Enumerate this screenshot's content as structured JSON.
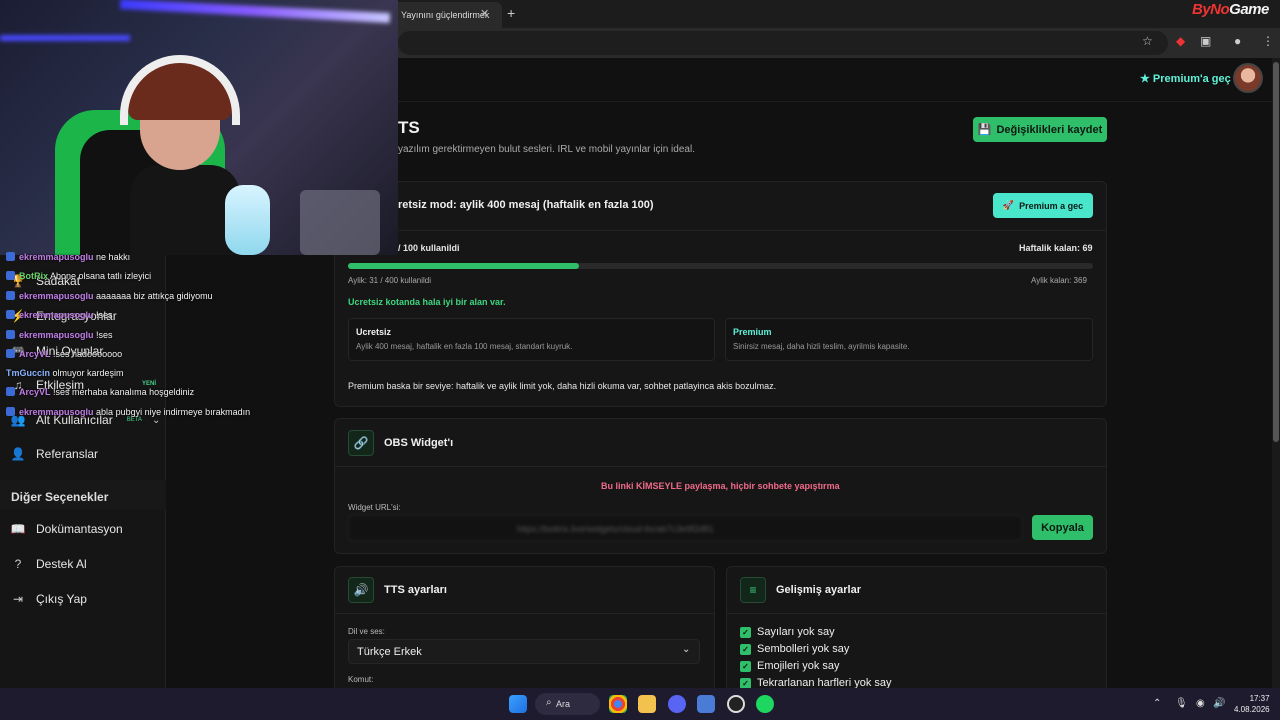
{
  "browser": {
    "tab_title": "Yayınını güçlendirmek",
    "tab_close": "✕",
    "new_tab": "+",
    "brand_left": "ByNo",
    "brand_right": "Game"
  },
  "topbar": {
    "premium_link": "Premium'a geç"
  },
  "header": {
    "title": "TS",
    "subtitle": "yazılım gerektirmeyen bulut sesleri. IRL ve mobil yayınlar için ideal.",
    "save_button": "Değişiklikleri kaydet"
  },
  "quota_card": {
    "mode_title": "retsiz mod: aylik 400 mesaj (haftalik en fazla 100)",
    "premium_button": "Premium a gec",
    "weekly_used": "/ 100 kullanildi",
    "weekly_left": "Haftalik kalan: 69",
    "weekly_progress": 0.31,
    "monthly_used": "Aylik: 31 / 400 kullanildi",
    "monthly_left": "Aylik kalan: 369",
    "status_message": "Ucretsiz kotanda hala iyi bir alan var.",
    "plans": [
      {
        "name": "Ucretsiz",
        "desc": "Aylik 400 mesaj, haftalik en fazla 100 mesaj, standart kuyruk."
      },
      {
        "name": "Premium",
        "desc": "Sinirsiz mesaj, daha hizli teslim, ayrilmis kapasite."
      }
    ],
    "premium_note": "Premium baska bir seviye: haftalik ve aylik limit yok, daha hizli okuma var, sohbet patlayinca akis bozulmaz."
  },
  "obs_card": {
    "title": "OBS Widget'ı",
    "warning": "Bu linki KİMSEYLE paylaşma, hiçbir sohbete yapıştırma",
    "url_label": "Widget URL'si:",
    "url_value": "https://bottrix.live/widgets/cloud-tts/ab7c3e9f2d81",
    "copy_button": "Kopyala"
  },
  "tts_card": {
    "title": "TTS ayarları",
    "voice_label": "Dil ve ses:",
    "voice_value": "Türkçe Erkek",
    "command_label": "Komut:"
  },
  "advanced_card": {
    "title": "Gelişmiş ayarlar",
    "options": [
      {
        "label": "Sayıları yok say",
        "checked": true
      },
      {
        "label": "Sembolleri yok say",
        "checked": true
      },
      {
        "label": "Emojileri yok say",
        "checked": true
      },
      {
        "label": "Tekrarlanan harfleri yok say",
        "checked": true
      }
    ]
  },
  "sidebar": {
    "items": [
      {
        "label": "Sadakat",
        "icon": "trophy-icon"
      },
      {
        "label": "Entegrasyonlar",
        "icon": "plug-icon"
      },
      {
        "label": "Mini Oyunlar",
        "icon": "gamepad-icon"
      },
      {
        "label": "Etkileşim",
        "icon": "music-icon"
      },
      {
        "label": "Alt Kullanıcılar",
        "icon": "users-icon",
        "badge": "BETA"
      },
      {
        "label": "Referanslar",
        "icon": "user-plus-icon"
      }
    ],
    "new_badge": "YENİ",
    "section_title": "Diğer Seçenekler",
    "other": [
      {
        "label": "Dokümantasyon",
        "icon": "book-icon"
      },
      {
        "label": "Destek Al",
        "icon": "help-icon"
      },
      {
        "label": "Çıkış Yap",
        "icon": "logout-icon"
      }
    ]
  },
  "chat": [
    {
      "user": "ekremmapusoglu",
      "text": "ne hakkı",
      "color": "#c07de8"
    },
    {
      "user": "BotRix",
      "text": "Abone olsana tatlı izleyici",
      "color": "#6bd36b"
    },
    {
      "user": "ekremmapusoglu",
      "text": "aaaaaaa biz attıkça gidiyomu",
      "color": "#c07de8"
    },
    {
      "user": "ekremmapusoglu",
      "text": "!ses",
      "color": "#c07de8"
    },
    {
      "user": "ekremmapusoglu",
      "text": "!ses",
      "color": "#c07de8"
    },
    {
      "user": "ArcyVL",
      "text": "!ses hadooooooo",
      "color": "#c07de8"
    },
    {
      "user": "TmGuccin",
      "text": "olmuyor kardeşim",
      "color": "#8ab4ff"
    },
    {
      "user": "ArcyVL",
      "text": "!ses merhaba kanalıma hoşgeldiniz",
      "color": "#c07de8"
    },
    {
      "user": "ekremmapusoglu",
      "text": "abla pubgyi niye indirmeye bırakmadın",
      "color": "#c07de8"
    }
  ],
  "taskbar": {
    "search_label": "Ara",
    "time": "17:37",
    "date": "4.08.2026"
  },
  "colors": {
    "accent_green": "#2fbf6a",
    "accent_teal": "#49e6cc",
    "warning_pink": "#f06a8a"
  }
}
